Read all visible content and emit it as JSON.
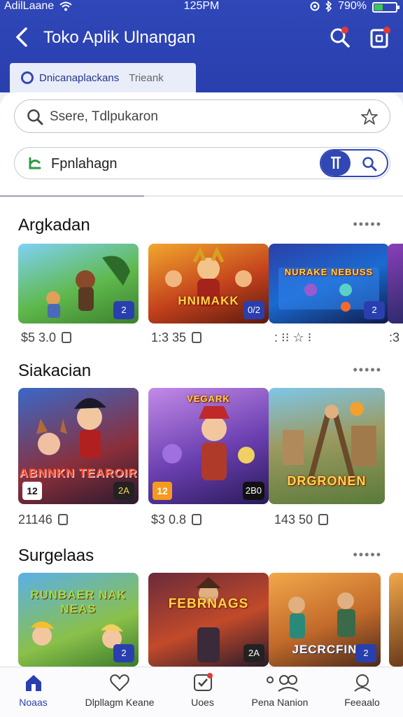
{
  "status_bar": {
    "carrier": "AdilLaane",
    "time": "125PM",
    "battery": "790%"
  },
  "header": {
    "title": "Toko Aplik Ulnangan"
  },
  "tabs": {
    "active": "Dnicanaplackans",
    "inactive": "Trieank"
  },
  "search": {
    "placeholder": "Ssere, Tdlpukaron"
  },
  "filter": {
    "label": "Fpnlahagn",
    "toggle_label": "r"
  },
  "sections": [
    {
      "title": "Argkadan",
      "more": "•••••",
      "items": [
        {
          "art_text": "",
          "tag": "2",
          "price": "$5 3.0"
        },
        {
          "art_text": "HNIMAKK",
          "tag": "0/2",
          "price": "1:3 35"
        },
        {
          "art_text": "NURAKE NEBUSS",
          "tag": "2",
          "price": ": ⁝⁝ ☆ ⁝"
        },
        {
          "art_text": "",
          "tag": "",
          "price": ":3"
        }
      ]
    },
    {
      "title": "Siakacian",
      "more": "•••••",
      "items": [
        {
          "art_text": "ABNNKN TEAROIR",
          "age": "12",
          "tag": "2A",
          "price": "21146"
        },
        {
          "art_text": "VEGARK",
          "age": "12",
          "tag": "2B0",
          "price": "$3 0.8"
        },
        {
          "art_text": "DRGRONEN",
          "age": "",
          "tag": "",
          "price": "143 50"
        }
      ]
    },
    {
      "title": "Surgelaas",
      "more": "•••••",
      "items": [
        {
          "art_text": "RUNBAER NAK NEAS",
          "tag": "2",
          "price": ""
        },
        {
          "art_text": "FEBRNAGS",
          "tag": "2A",
          "price": ""
        },
        {
          "art_text": "JECRCFIN",
          "tag": "2",
          "price": ""
        },
        {
          "art_text": "",
          "tag": "",
          "price": ""
        }
      ]
    }
  ],
  "bottom_nav": [
    {
      "label": "Noaas",
      "icon": "home-icon",
      "active": true
    },
    {
      "label": "Dlpllagm Keane",
      "icon": "heart-icon",
      "active": false
    },
    {
      "label": "Uoes",
      "icon": "check-icon",
      "active": false
    },
    {
      "label": "Pena Nanion",
      "icon": "people-icon",
      "active": false
    },
    {
      "label": "Feeaalo",
      "icon": "profile-icon",
      "active": false
    }
  ],
  "colors": {
    "primary": "#2a3fae",
    "badge": "#e53935"
  }
}
